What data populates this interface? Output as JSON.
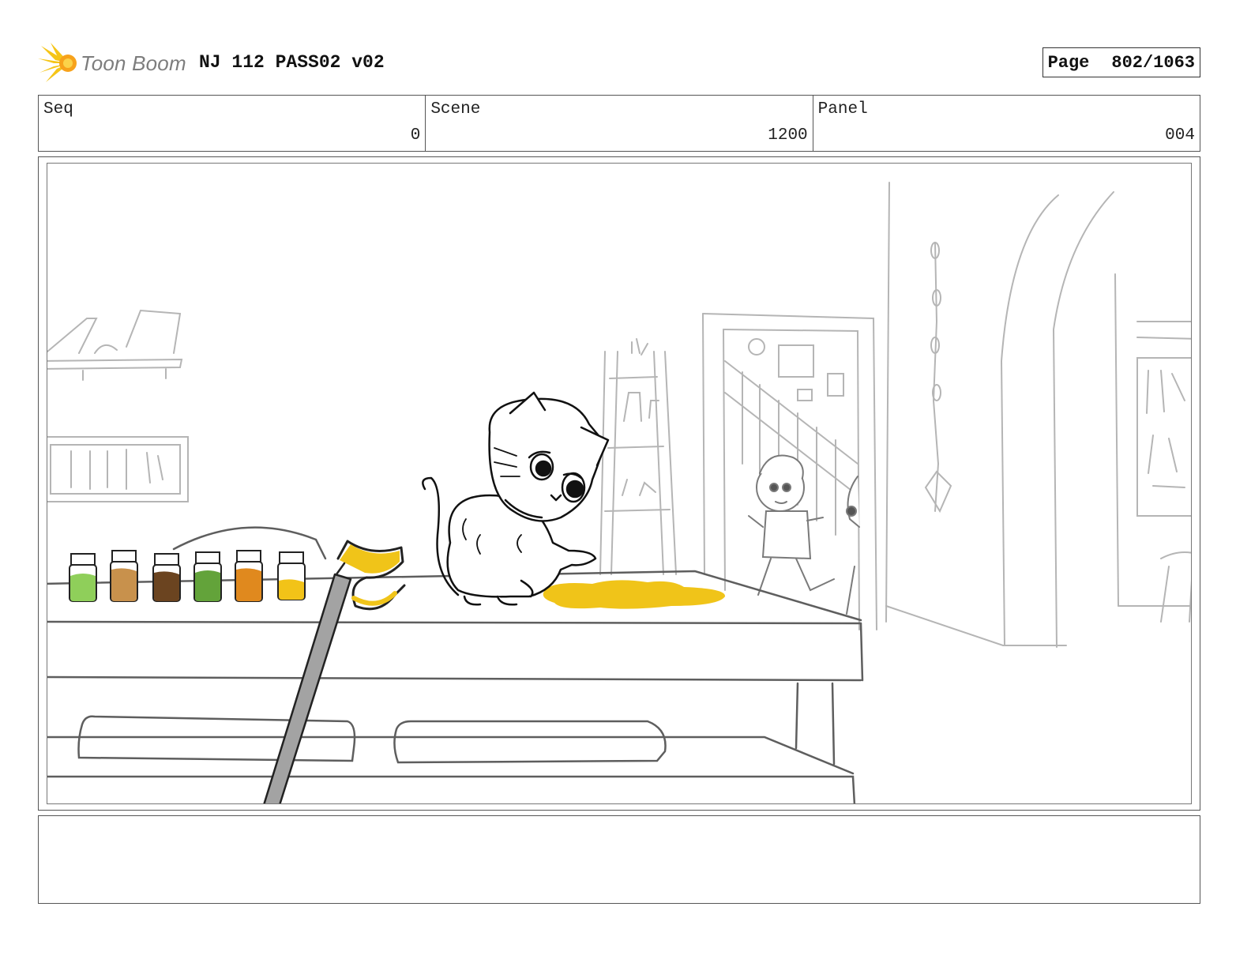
{
  "logo": {
    "text": "Toon Boom",
    "icon": "toon-boom-star-icon"
  },
  "project_title": "NJ 112 PASS02 v02",
  "page": {
    "label": "Page",
    "value": "802/1063"
  },
  "fields": {
    "seq": {
      "label": "Seq",
      "value": "0"
    },
    "scene": {
      "label": "Scene",
      "value": "1200"
    },
    "panel": {
      "label": "Panel",
      "value": "004"
    }
  },
  "caption": "",
  "colors": {
    "accent_yellow": "#f0c419",
    "jar_colors": [
      "#8fcf5a",
      "#c8914c",
      "#6b4420",
      "#63a33a",
      "#e0891e",
      "#f2c318"
    ]
  }
}
